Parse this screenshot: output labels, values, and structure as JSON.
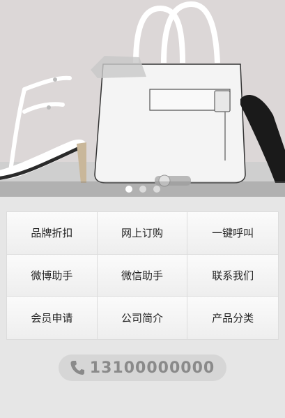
{
  "banner": {
    "image_desc": "white handbag, white heels, black clutch and watch",
    "dots": [
      {
        "active": true
      },
      {
        "active": false
      },
      {
        "active": false
      }
    ]
  },
  "menu": {
    "items": [
      {
        "label": "品牌折扣"
      },
      {
        "label": "网上订购"
      },
      {
        "label": "一键呼叫"
      },
      {
        "label": "微博助手"
      },
      {
        "label": "微信助手"
      },
      {
        "label": "联系我们"
      },
      {
        "label": "会员申请"
      },
      {
        "label": "公司简介"
      },
      {
        "label": "产品分类"
      }
    ]
  },
  "contact": {
    "phone": "13100000000",
    "icon": "phone-icon"
  }
}
